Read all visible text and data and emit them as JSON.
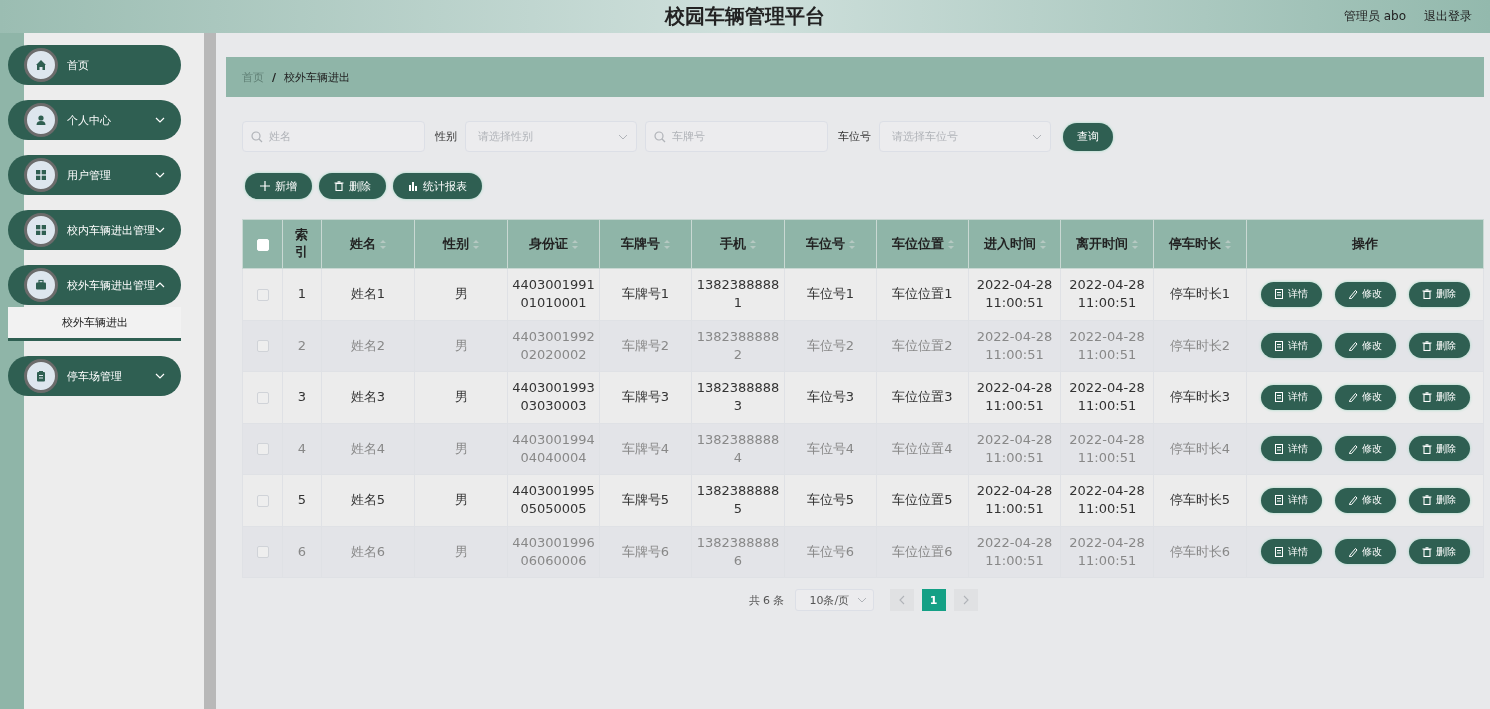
{
  "header": {
    "title": "校园车辆管理平台",
    "user": "管理员 abo",
    "logout": "退出登录"
  },
  "sidebar": {
    "items": [
      {
        "label": "首页",
        "has_children": false
      },
      {
        "label": "个人中心",
        "has_children": true,
        "expanded": false
      },
      {
        "label": "用户管理",
        "has_children": true,
        "expanded": false
      },
      {
        "label": "校内车辆进出管理",
        "has_children": true,
        "expanded": false
      },
      {
        "label": "校外车辆进出管理",
        "has_children": true,
        "expanded": true,
        "children": [
          {
            "label": "校外车辆进出",
            "selected": true
          }
        ]
      },
      {
        "label": "停车场管理",
        "has_children": true,
        "expanded": false
      }
    ]
  },
  "breadcrumb": [
    "首页",
    "/",
    "校外车辆进出"
  ],
  "filters": [
    {
      "kind": "search",
      "placeholder": "姓名"
    },
    {
      "kind": "select",
      "label": "性别",
      "placeholder": "请选择性别"
    },
    {
      "kind": "search",
      "placeholder": "车牌号"
    },
    {
      "kind": "select",
      "label": "车位号",
      "placeholder": "请选择车位号"
    }
  ],
  "query_button": "查询",
  "toolbar": [
    {
      "kind": "add",
      "label": "新增"
    },
    {
      "kind": "delete",
      "label": "删除"
    },
    {
      "kind": "chart",
      "label": "统计报表"
    }
  ],
  "table": {
    "select_all_checked": false,
    "columns": [
      {
        "label": "索引",
        "sortable": false
      },
      {
        "label": "姓名",
        "sortable": true
      },
      {
        "label": "性别",
        "sortable": true
      },
      {
        "label": "身份证",
        "sortable": true
      },
      {
        "label": "车牌号",
        "sortable": true
      },
      {
        "label": "手机",
        "sortable": true
      },
      {
        "label": "车位号",
        "sortable": true
      },
      {
        "label": "车位位置",
        "sortable": true
      },
      {
        "label": "进入时间",
        "sortable": true
      },
      {
        "label": "离开时间",
        "sortable": true
      },
      {
        "label": "停车时长",
        "sortable": true
      },
      {
        "label": "操作",
        "sortable": false
      }
    ],
    "rows": [
      {
        "checked": false,
        "cells": [
          "1",
          "姓名1",
          "男",
          "440300199101010001",
          "车牌号1",
          "13823888881",
          "车位号1",
          "车位位置1",
          "2022-04-28 11:00:51",
          "2022-04-28 11:00:51",
          "停车时长1"
        ],
        "actions": [
          {
            "kind": "detail",
            "label": "详情"
          },
          {
            "kind": "edit",
            "label": "修改"
          },
          {
            "kind": "delete",
            "label": "删除"
          }
        ]
      },
      {
        "checked": false,
        "cells": [
          "2",
          "姓名2",
          "男",
          "440300199202020002",
          "车牌号2",
          "13823888882",
          "车位号2",
          "车位位置2",
          "2022-04-28 11:00:51",
          "2022-04-28 11:00:51",
          "停车时长2"
        ],
        "actions": [
          {
            "kind": "detail",
            "label": "详情"
          },
          {
            "kind": "edit",
            "label": "修改"
          },
          {
            "kind": "delete",
            "label": "删除"
          }
        ]
      },
      {
        "checked": false,
        "cells": [
          "3",
          "姓名3",
          "男",
          "440300199303030003",
          "车牌号3",
          "13823888883",
          "车位号3",
          "车位位置3",
          "2022-04-28 11:00:51",
          "2022-04-28 11:00:51",
          "停车时长3"
        ],
        "actions": [
          {
            "kind": "detail",
            "label": "详情"
          },
          {
            "kind": "edit",
            "label": "修改"
          },
          {
            "kind": "delete",
            "label": "删除"
          }
        ]
      },
      {
        "checked": false,
        "cells": [
          "4",
          "姓名4",
          "男",
          "440300199404040004",
          "车牌号4",
          "13823888884",
          "车位号4",
          "车位位置4",
          "2022-04-28 11:00:51",
          "2022-04-28 11:00:51",
          "停车时长4"
        ],
        "actions": [
          {
            "kind": "detail",
            "label": "详情"
          },
          {
            "kind": "edit",
            "label": "修改"
          },
          {
            "kind": "delete",
            "label": "删除"
          }
        ]
      },
      {
        "checked": false,
        "cells": [
          "5",
          "姓名5",
          "男",
          "440300199505050005",
          "车牌号5",
          "13823888885",
          "车位号5",
          "车位位置5",
          "2022-04-28 11:00:51",
          "2022-04-28 11:00:51",
          "停车时长5"
        ],
        "actions": [
          {
            "kind": "detail",
            "label": "详情"
          },
          {
            "kind": "edit",
            "label": "修改"
          },
          {
            "kind": "delete",
            "label": "删除"
          }
        ]
      },
      {
        "checked": false,
        "cells": [
          "6",
          "姓名6",
          "男",
          "440300199606060006",
          "车牌号6",
          "13823888886",
          "车位号6",
          "车位位置6",
          "2022-04-28 11:00:51",
          "2022-04-28 11:00:51",
          "停车时长6"
        ],
        "actions": [
          {
            "kind": "detail",
            "label": "详情"
          },
          {
            "kind": "edit",
            "label": "修改"
          },
          {
            "kind": "delete",
            "label": "删除"
          }
        ]
      }
    ]
  },
  "pagination": {
    "total": "共 6 条",
    "page_size": "10条/页",
    "pages": [
      {
        "label": "1",
        "selected": true
      }
    ]
  }
}
